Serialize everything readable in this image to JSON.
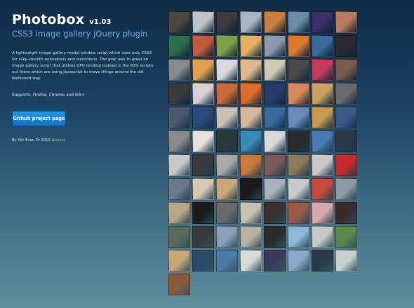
{
  "header": {
    "title": "Photobox",
    "version": "v1.03",
    "subtitle": "CSS3 image gallery jQuery plugin"
  },
  "description": "A lightweight image gallery modal window script which uses only CSS3 for silky-smooth animations and transitions. The goal was to great an image gallery script that utilizes GPU rending instead is the 90% scripts out there which are using Javascript to move things around the old fashioned way.",
  "supports": "Supports: Firefox, Chrome and IE9+",
  "button": {
    "label": "Github project page"
  },
  "byline": {
    "text": "By Yair Even Or 2012",
    "handle": "@vsync"
  },
  "gallery": {
    "rows": [
      [
        "#4a4640",
        "#bfc5c7",
        "#3a3c40",
        "#a7b6c2",
        "#c9803a",
        "#6a8aa8",
        "#3c2f6a",
        "#b87a5c"
      ],
      [
        "#2d6e4a",
        "#c25a3c",
        "#7fa04a",
        "#e2b060",
        "#8a9aa8",
        "#d87a2a",
        "#3a6a9a",
        "#2a2a30"
      ],
      [
        "#8a8a8a",
        "#e0a050",
        "#d8d8dc",
        "#e0b890",
        "#d0c8b0",
        "#4a4a4a",
        "#c83a5a",
        "#7a5a4a"
      ],
      [
        "#3a3a3a",
        "#d8d0d0",
        "#c86a3a",
        "#e06a2a",
        "#2a3a6a",
        "#d8885a",
        "#c8a060",
        "#6a6a6a"
      ],
      [
        "#4a5a6a",
        "#2a4a7a",
        "#c8c0b0",
        "#d8b89a",
        "#3a6a9a",
        "#6a8ab8",
        "#c89a4a",
        "#3a5a8a"
      ],
      [
        "#8a8a8a",
        "#e8e0d8",
        "#2a3a3a",
        "#3a8ab8",
        "#d8d8d8",
        "#2a2a2a",
        "#4a7ab8",
        "#2a3a4a"
      ],
      [
        "#c8c8c8",
        "#3a3a3a",
        "#a8a8a8",
        "#c87a3a",
        "#7a5a5a",
        "#8a7a5a",
        "#c8c8c8",
        "#c82a2a"
      ],
      [
        "#6a7a8a",
        "#d8c8b0",
        "#c8a878",
        "#1a1a1a",
        "#a8b0b8",
        "#c8c8c8",
        "#c84a3a",
        "#8a9aa0"
      ],
      [
        "#b8a888",
        "#1a1a1a",
        "#6a6a6a",
        "#c8c0b0",
        "#3a3030",
        "#9a5a4a",
        "#d8a8a8",
        "#3a2a2a"
      ],
      [
        "#5a6a5a",
        "#3a3a3a",
        "#8aa0b8",
        "#b8b0a0",
        "#2a2a2a",
        "#8ab8d8",
        "#c8c8c8",
        "#5a8a4a"
      ],
      [
        "#c8a878",
        "#2a4a6a",
        "#4a7aa8",
        "#d8d8d8",
        "#3a3a5a",
        "#8aa8c8",
        "#2a3a4a",
        "#c8d0d0"
      ],
      [
        "#8a5a3a"
      ]
    ]
  }
}
